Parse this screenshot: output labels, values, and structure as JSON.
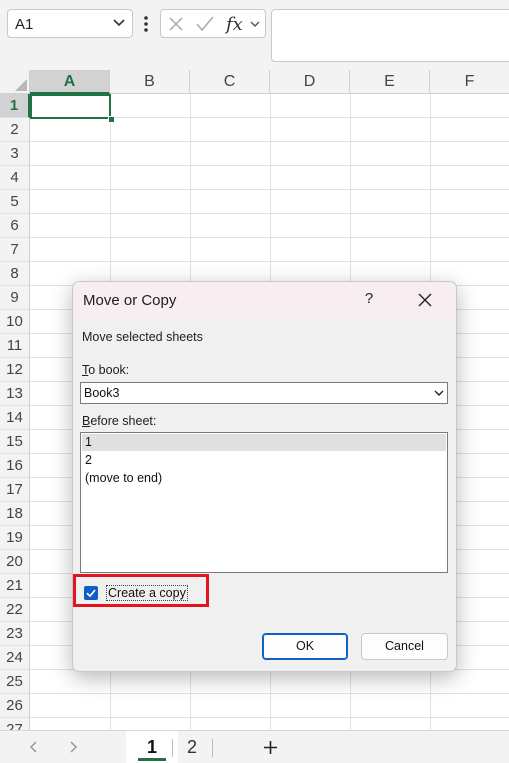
{
  "formula_bar": {
    "name_box": "A1",
    "formula_value": ""
  },
  "columns": [
    "A",
    "B",
    "C",
    "D",
    "E",
    "F"
  ],
  "rows": [
    "1",
    "2",
    "3",
    "4",
    "5",
    "6",
    "7",
    "8",
    "9",
    "10",
    "11",
    "12",
    "13",
    "14",
    "15",
    "16",
    "17",
    "18",
    "19",
    "20",
    "21",
    "22",
    "23",
    "24",
    "25",
    "26",
    "27"
  ],
  "sheet_tabs": [
    "1",
    "2"
  ],
  "dialog": {
    "title": "Move or Copy",
    "help": "?",
    "description": "Move selected sheets",
    "to_book_label_key": "T",
    "to_book_label_rest": "o book:",
    "to_book_value": "Book3",
    "before_sheet_label_key": "B",
    "before_sheet_label_rest": "efore sheet:",
    "before_sheet_items": [
      "1",
      "2",
      "(move to end)"
    ],
    "create_copy_label": "Create a copy",
    "create_copy_checked": true,
    "ok_label": "OK",
    "cancel_label": "Cancel"
  },
  "colors": {
    "excel_green": "#217346",
    "checkbox_blue": "#0f5fc6",
    "highlight_red": "#e3141e"
  }
}
